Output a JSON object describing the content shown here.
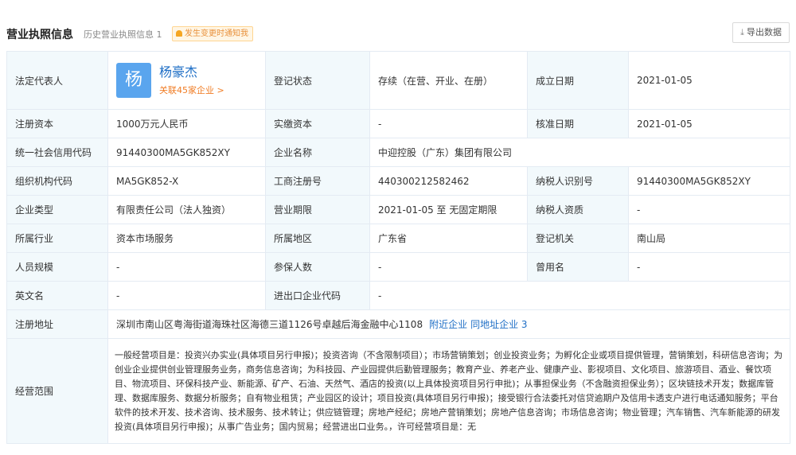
{
  "header": {
    "title": "营业执照信息",
    "history": "历史营业执照信息 1",
    "notify": "发生变更时通知我",
    "export_label": "导出数据"
  },
  "rows": {
    "legal_rep": {
      "label": "法定代表人",
      "avatar": "杨",
      "name": "杨豪杰",
      "related": "关联45家企业 >",
      "status_label": "登记状态",
      "status_value": "存续（在营、开业、在册）",
      "est_label": "成立日期",
      "est_value": "2021-01-05"
    },
    "capital": {
      "label": "注册资本",
      "value": "1000万元人民币",
      "paid_label": "实缴资本",
      "paid_value": "-",
      "approve_label": "核准日期",
      "approve_value": "2021-01-05"
    },
    "credit": {
      "label": "统一社会信用代码",
      "value": "91440300MA5GK852XY",
      "name_label": "企业名称",
      "name_value": "中迎控股（广东）集团有限公司"
    },
    "org": {
      "label": "组织机构代码",
      "value": "MA5GK852-X",
      "reg_label": "工商注册号",
      "reg_value": "440300212582462",
      "tax_label": "纳税人识别号",
      "tax_value": "91440300MA5GK852XY"
    },
    "type": {
      "label": "企业类型",
      "value": "有限责任公司（法人独资）",
      "term_label": "营业期限",
      "term_value": "2021-01-05 至 无固定期限",
      "taxq_label": "纳税人资质",
      "taxq_value": "-"
    },
    "industry": {
      "label": "所属行业",
      "value": "资本市场服务",
      "region_label": "所属地区",
      "region_value": "广东省",
      "authority_label": "登记机关",
      "authority_value": "南山局"
    },
    "staff": {
      "label": "人员规模",
      "value": "-",
      "insured_label": "参保人数",
      "insured_value": "-",
      "former_label": "曾用名",
      "former_value": "-"
    },
    "english": {
      "label": "英文名",
      "value": "-",
      "ie_label": "进出口企业代码",
      "ie_value": "-"
    },
    "address": {
      "label": "注册地址",
      "value": "深圳市南山区粤海街道海珠社区海德三道1126号卓越后海金融中心1108",
      "nearby": "附近企业",
      "same": "同地址企业 3"
    },
    "scope": {
      "label": "经营范围",
      "value": "一般经营项目是：投资兴办实业(具体项目另行申报)；投资咨询（不含限制项目）；市场营销策划；创业投资业务；为孵化企业或项目提供管理，营销策划，科研信息咨询；为创业企业提供创业管理服务业务，商务信息咨询；为科技园、产业园提供后勤管理服务；教育产业、养老产业、健康产业、影视项目、文化项目、旅游项目、酒业、餐饮项目、物流项目、环保科技产业、新能源、矿产、石油、天然气、酒店的投资(以上具体投资项目另行申批)；从事担保业务（不含融资担保业务）；区块链技术开发；数据库管理、数据库服务、数据分析服务；自有物业租赁；产业园区的设计；项目投资(具体项目另行申报)；接受银行合法委托对信贷逾期户及信用卡透支户进行电话通知服务；平台软件的技术开发、技术咨询、技术服务、技术转让；供应链管理；房地产经纪；房地产营销策划；房地产信息咨询；市场信息咨询；物业管理；汽车销售、汽车新能源的研发投资(具体项目另行申报)；从事广告业务；国内贸易；经营进出口业务。，许可经营项目是：无"
    }
  }
}
